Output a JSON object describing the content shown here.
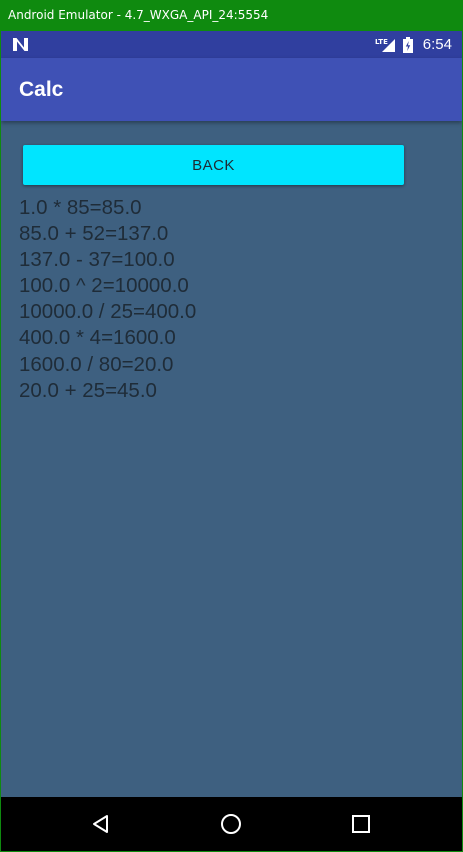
{
  "window": {
    "title": "Android Emulator - 4.7_WXGA_API_24:5554"
  },
  "status_bar": {
    "notification_icon": "n-letter-icon",
    "signal_label": "LTE",
    "time": "6:54",
    "background": "#303f9f"
  },
  "app_bar": {
    "title": "Calc",
    "background": "#3f51b5"
  },
  "main": {
    "back_button_label": "BACK",
    "back_button_color": "#00e5ff",
    "background": "#3e6080",
    "history": [
      "1.0 * 85=85.0",
      "85.0 + 52=137.0",
      "137.0 - 37=100.0",
      "100.0 ^ 2=10000.0",
      "10000.0 / 25=400.0",
      "400.0 * 4=1600.0",
      "1600.0 / 80=20.0",
      "20.0 + 25=45.0"
    ]
  },
  "nav_bar": {
    "back_icon": "triangle-back-icon",
    "home_icon": "circle-home-icon",
    "recents_icon": "square-recents-icon"
  }
}
